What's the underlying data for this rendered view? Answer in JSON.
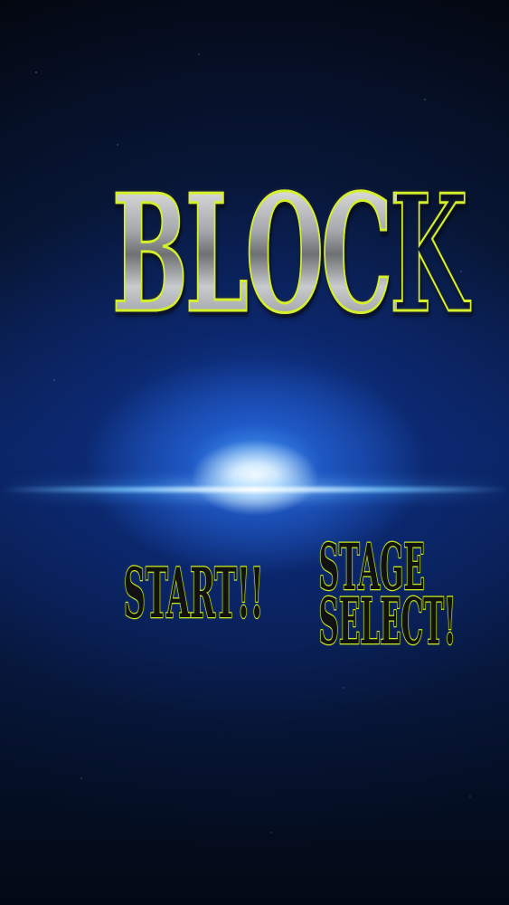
{
  "game": {
    "title": "BLOCK",
    "menu": {
      "start_label": "START!!",
      "stage_select_line1": "STAGE",
      "stage_select_line2": "SELECT!"
    }
  },
  "colors": {
    "title_outline": "#d4f02a",
    "button_outline": "#c8e81e",
    "background": "#061227",
    "flare": "#78c8ff"
  }
}
